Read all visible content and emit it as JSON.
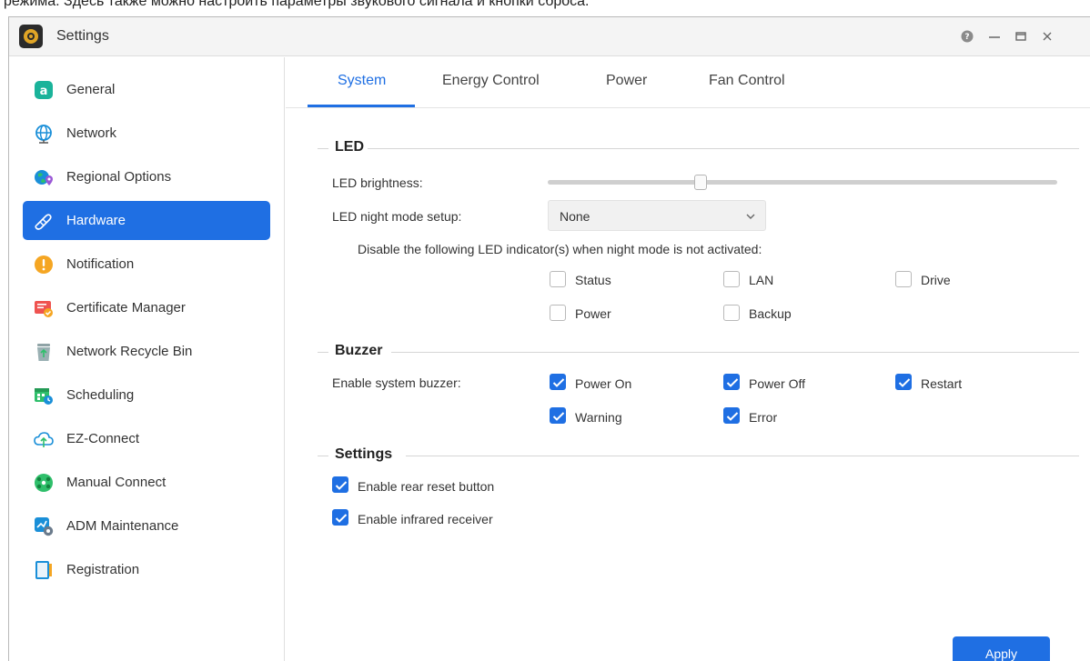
{
  "caption": "режима. Здесь также можно настроить параметры звукового сигнала и кнопки сброса.",
  "window": {
    "title": "Settings"
  },
  "sidebar": {
    "items": [
      {
        "label": "General",
        "icon": "general-icon"
      },
      {
        "label": "Network",
        "icon": "globe-icon"
      },
      {
        "label": "Regional Options",
        "icon": "regional-options-icon"
      },
      {
        "label": "Hardware",
        "icon": "hardware-icon",
        "active": true
      },
      {
        "label": "Notification",
        "icon": "notification-icon"
      },
      {
        "label": "Certificate Manager",
        "icon": "certificate-icon"
      },
      {
        "label": "Network Recycle Bin",
        "icon": "recycle-bin-icon"
      },
      {
        "label": "Scheduling",
        "icon": "scheduling-icon"
      },
      {
        "label": "EZ-Connect",
        "icon": "cloud-upload-icon"
      },
      {
        "label": "Manual Connect",
        "icon": "manual-connect-icon"
      },
      {
        "label": "ADM Maintenance",
        "icon": "maintenance-icon"
      },
      {
        "label": "Registration",
        "icon": "registration-icon"
      }
    ]
  },
  "tabs": [
    {
      "label": "System",
      "active": true
    },
    {
      "label": "Energy Control"
    },
    {
      "label": "Power"
    },
    {
      "label": "Fan Control"
    }
  ],
  "led": {
    "title": "LED",
    "brightness_label": "LED brightness:",
    "brightness_fraction": 0.3,
    "night_mode_label": "LED night mode setup:",
    "night_mode_value": "None",
    "disable_note": "Disable the following LED indicator(s) when night mode is not activated:",
    "indicators": [
      {
        "label": "Status",
        "checked": false
      },
      {
        "label": "LAN",
        "checked": false
      },
      {
        "label": "Drive",
        "checked": false
      },
      {
        "label": "Power",
        "checked": false
      },
      {
        "label": "Backup",
        "checked": false
      }
    ]
  },
  "buzzer": {
    "title": "Buzzer",
    "enable_label": "Enable system buzzer:",
    "options": [
      {
        "label": "Power On",
        "checked": true
      },
      {
        "label": "Power Off",
        "checked": true
      },
      {
        "label": "Restart",
        "checked": true
      },
      {
        "label": "Warning",
        "checked": true
      },
      {
        "label": "Error",
        "checked": true
      }
    ]
  },
  "settings": {
    "title": "Settings",
    "options": [
      {
        "label": "Enable rear reset button",
        "checked": true
      },
      {
        "label": "Enable infrared receiver",
        "checked": true
      }
    ]
  },
  "actions": {
    "apply": "Apply"
  },
  "colors": {
    "accent": "#1f6fe3"
  }
}
